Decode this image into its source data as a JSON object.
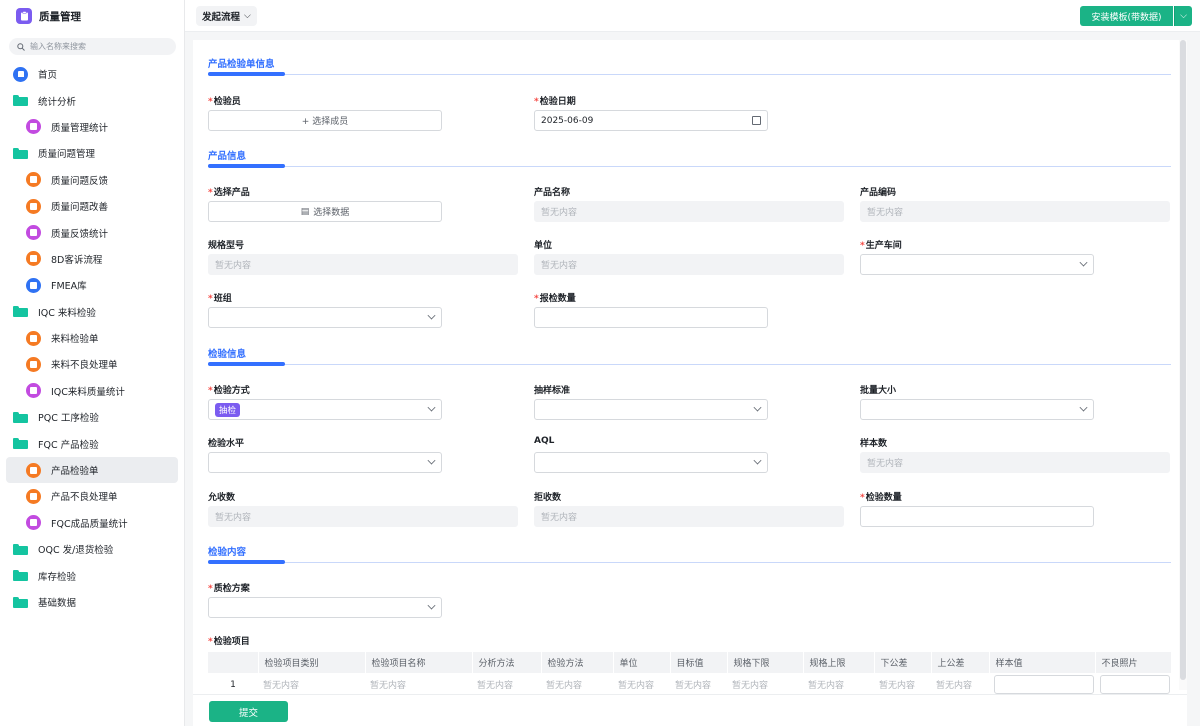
{
  "app": {
    "title": "质量管理"
  },
  "search": {
    "placeholder": "输入名称来搜索"
  },
  "nav": [
    {
      "label": "首页",
      "level": 1,
      "icon": "home-icon",
      "color": "#2f72f3",
      "type": "circle"
    },
    {
      "label": "统计分析",
      "level": 1,
      "icon": "folder-icon",
      "type": "folder"
    },
    {
      "label": "质量管理统计",
      "level": 2,
      "icon": "chart-icon",
      "color": "#c24be0",
      "type": "circle"
    },
    {
      "label": "质量问题管理",
      "level": 1,
      "icon": "folder-icon",
      "type": "folder"
    },
    {
      "label": "质量问题反馈",
      "level": 2,
      "icon": "form-icon",
      "color": "#f57a23",
      "type": "circle"
    },
    {
      "label": "质量问题改善",
      "level": 2,
      "icon": "form-icon",
      "color": "#f57a23",
      "type": "circle"
    },
    {
      "label": "质量反馈统计",
      "level": 2,
      "icon": "chart-icon",
      "color": "#c24be0",
      "type": "circle"
    },
    {
      "label": "8D客诉流程",
      "level": 2,
      "icon": "flow-icon",
      "color": "#f57a23",
      "type": "circle"
    },
    {
      "label": "FMEA库",
      "level": 2,
      "icon": "database-icon",
      "color": "#2f72f3",
      "type": "circle"
    },
    {
      "label": "IQC 来料检验",
      "level": 1,
      "icon": "folder-icon",
      "type": "folder"
    },
    {
      "label": "来料检验单",
      "level": 2,
      "icon": "flow-icon",
      "color": "#f57a23",
      "type": "circle"
    },
    {
      "label": "来料不良处理单",
      "level": 2,
      "icon": "form-icon",
      "color": "#f57a23",
      "type": "circle"
    },
    {
      "label": "IQC来料质量统计",
      "level": 2,
      "icon": "chart-icon",
      "color": "#c24be0",
      "type": "circle"
    },
    {
      "label": "PQC 工序检验",
      "level": 1,
      "icon": "folder-icon",
      "type": "folder"
    },
    {
      "label": "FQC 产品检验",
      "level": 1,
      "icon": "folder-icon",
      "type": "folder"
    },
    {
      "label": "产品检验单",
      "level": 2,
      "icon": "box-icon",
      "color": "#f57a23",
      "type": "circle",
      "active": true
    },
    {
      "label": "产品不良处理单",
      "level": 2,
      "icon": "form-icon",
      "color": "#f57a23",
      "type": "circle"
    },
    {
      "label": "FQC成品质量统计",
      "level": 2,
      "icon": "chart-icon",
      "color": "#c24be0",
      "type": "circle"
    },
    {
      "label": "OQC 发/退货检验",
      "level": 1,
      "icon": "folder-icon",
      "type": "folder"
    },
    {
      "label": "库存检验",
      "level": 1,
      "icon": "folder-icon",
      "type": "folder"
    },
    {
      "label": "基础数据",
      "level": 1,
      "icon": "folder-icon",
      "type": "folder"
    }
  ],
  "topbar": {
    "flow": "发起流程",
    "template": "安装模板(带数据)"
  },
  "sections": {
    "s1": "产品检验单信息",
    "s2": "产品信息",
    "s3": "检验信息",
    "s4": "检验内容"
  },
  "fields": {
    "inspector": {
      "label": "检验员",
      "value": "+ 选择成员"
    },
    "date": {
      "label": "检验日期",
      "value": "2025-06-09"
    },
    "product": {
      "label": "选择产品",
      "value": "选择数据"
    },
    "product_name": {
      "label": "产品名称",
      "value": "暂无内容"
    },
    "product_code": {
      "label": "产品编码",
      "value": "暂无内容"
    },
    "spec": {
      "label": "规格型号",
      "value": "暂无内容"
    },
    "unit": {
      "label": "单位",
      "value": "暂无内容"
    },
    "workshop": {
      "label": "生产车间",
      "value": ""
    },
    "team": {
      "label": "班组",
      "value": ""
    },
    "qty": {
      "label": "报检数量",
      "value": ""
    },
    "method": {
      "label": "检验方式",
      "value": "抽检"
    },
    "sampling": {
      "label": "抽样标准",
      "value": ""
    },
    "batch": {
      "label": "批量大小",
      "value": ""
    },
    "level": {
      "label": "检验水平",
      "value": ""
    },
    "aql": {
      "label": "AQL",
      "value": ""
    },
    "sample": {
      "label": "样本数",
      "value": "暂无内容"
    },
    "accept": {
      "label": "允收数",
      "value": "暂无内容"
    },
    "reject": {
      "label": "拒收数",
      "value": "暂无内容"
    },
    "inspect_qty": {
      "label": "检验数量",
      "value": ""
    },
    "plan": {
      "label": "质检方案",
      "value": ""
    },
    "items": {
      "label": "检验项目"
    }
  },
  "table": {
    "headers": [
      "",
      "检验项目类别",
      "检验项目名称",
      "分析方法",
      "检验方法",
      "单位",
      "目标值",
      "规格下限",
      "规格上限",
      "下公差",
      "上公差",
      "样本值",
      "不良照片"
    ],
    "row": [
      "1",
      "暂无内容",
      "暂无内容",
      "暂无内容",
      "暂无内容",
      "暂无内容",
      "暂无内容",
      "暂无内容",
      "暂无内容",
      "暂无内容",
      "暂无内容",
      "",
      ""
    ]
  },
  "footer": {
    "submit": "提交"
  }
}
